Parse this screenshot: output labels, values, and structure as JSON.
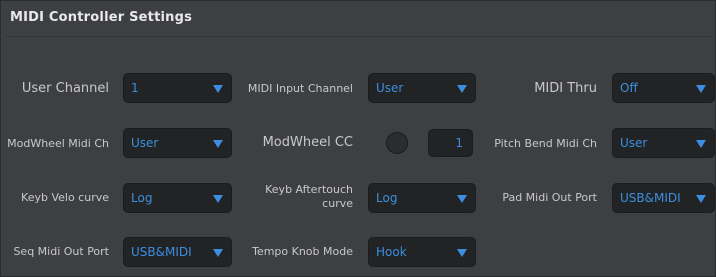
{
  "title": "MIDI Controller Settings",
  "settings": {
    "user_channel": {
      "label": "User Channel",
      "value": "1"
    },
    "midi_input_channel": {
      "label": "MIDI Input Channel",
      "value": "User"
    },
    "midi_thru": {
      "label": "MIDI Thru",
      "value": "Off"
    },
    "modwheel_midi_ch": {
      "label": "ModWheel Midi Ch",
      "value": "User"
    },
    "modwheel_cc": {
      "label": "ModWheel CC",
      "value": "1"
    },
    "pitch_bend_midi_ch": {
      "label": "Pitch Bend Midi Ch",
      "value": "User"
    },
    "keyb_velo_curve": {
      "label": "Keyb Velo curve",
      "value": "Log"
    },
    "keyb_aftertouch_curve": {
      "label": "Keyb Aftertouch curve",
      "value": "Log"
    },
    "pad_midi_out_port": {
      "label": "Pad Midi Out Port",
      "value": "USB&MIDI"
    },
    "seq_midi_out_port": {
      "label": "Seq Midi Out Port",
      "value": "USB&MIDI"
    },
    "tempo_knob_mode": {
      "label": "Tempo Knob Mode",
      "value": "Hook"
    }
  },
  "colors": {
    "panel": "#3d3f42",
    "field": "#222325",
    "value_text": "#3c8fe0",
    "label_text": "#c9c9c9"
  }
}
